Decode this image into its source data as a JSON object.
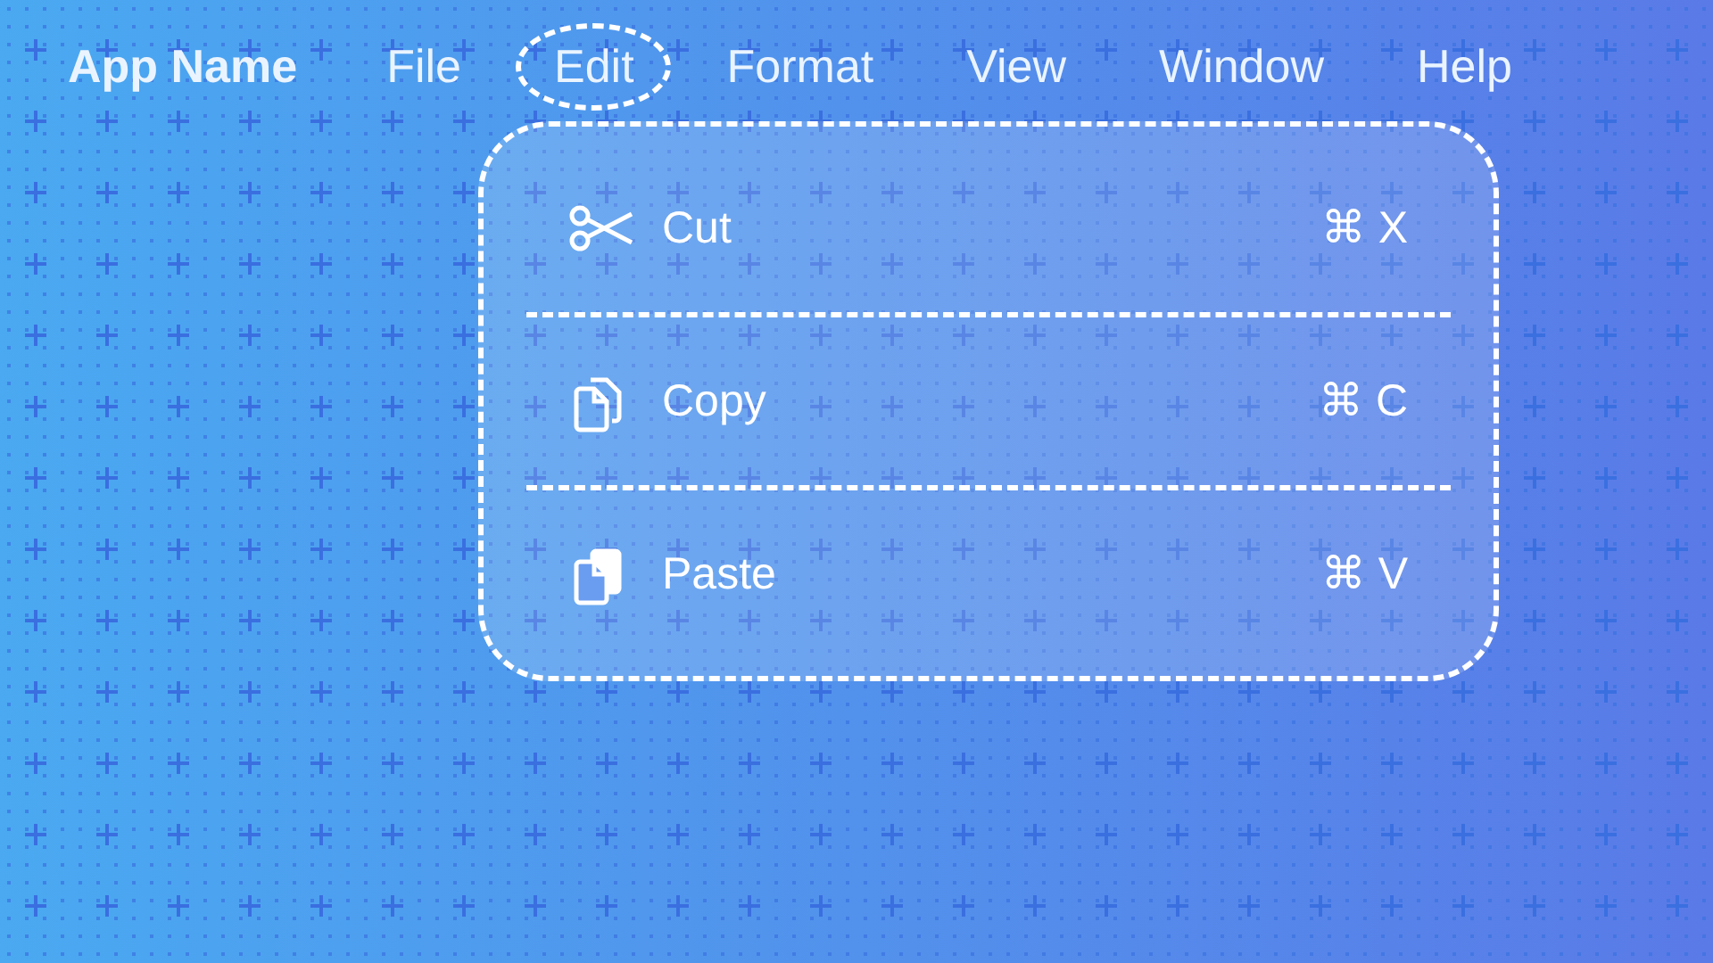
{
  "app_name": "App Name",
  "menu_bar": [
    {
      "label": "File",
      "selected": false
    },
    {
      "label": "Edit",
      "selected": true
    },
    {
      "label": "Format",
      "selected": false
    },
    {
      "label": "View",
      "selected": false
    },
    {
      "label": "Window",
      "selected": false
    },
    {
      "label": "Help",
      "selected": false
    }
  ],
  "menu": [
    {
      "kind": "scissors",
      "label": "Cut",
      "shortcut": "⌘ X"
    },
    {
      "kind": "copy",
      "label": "Copy",
      "shortcut": "⌘ C"
    },
    {
      "kind": "paste",
      "label": "Paste",
      "shortcut": "⌘ V"
    }
  ]
}
